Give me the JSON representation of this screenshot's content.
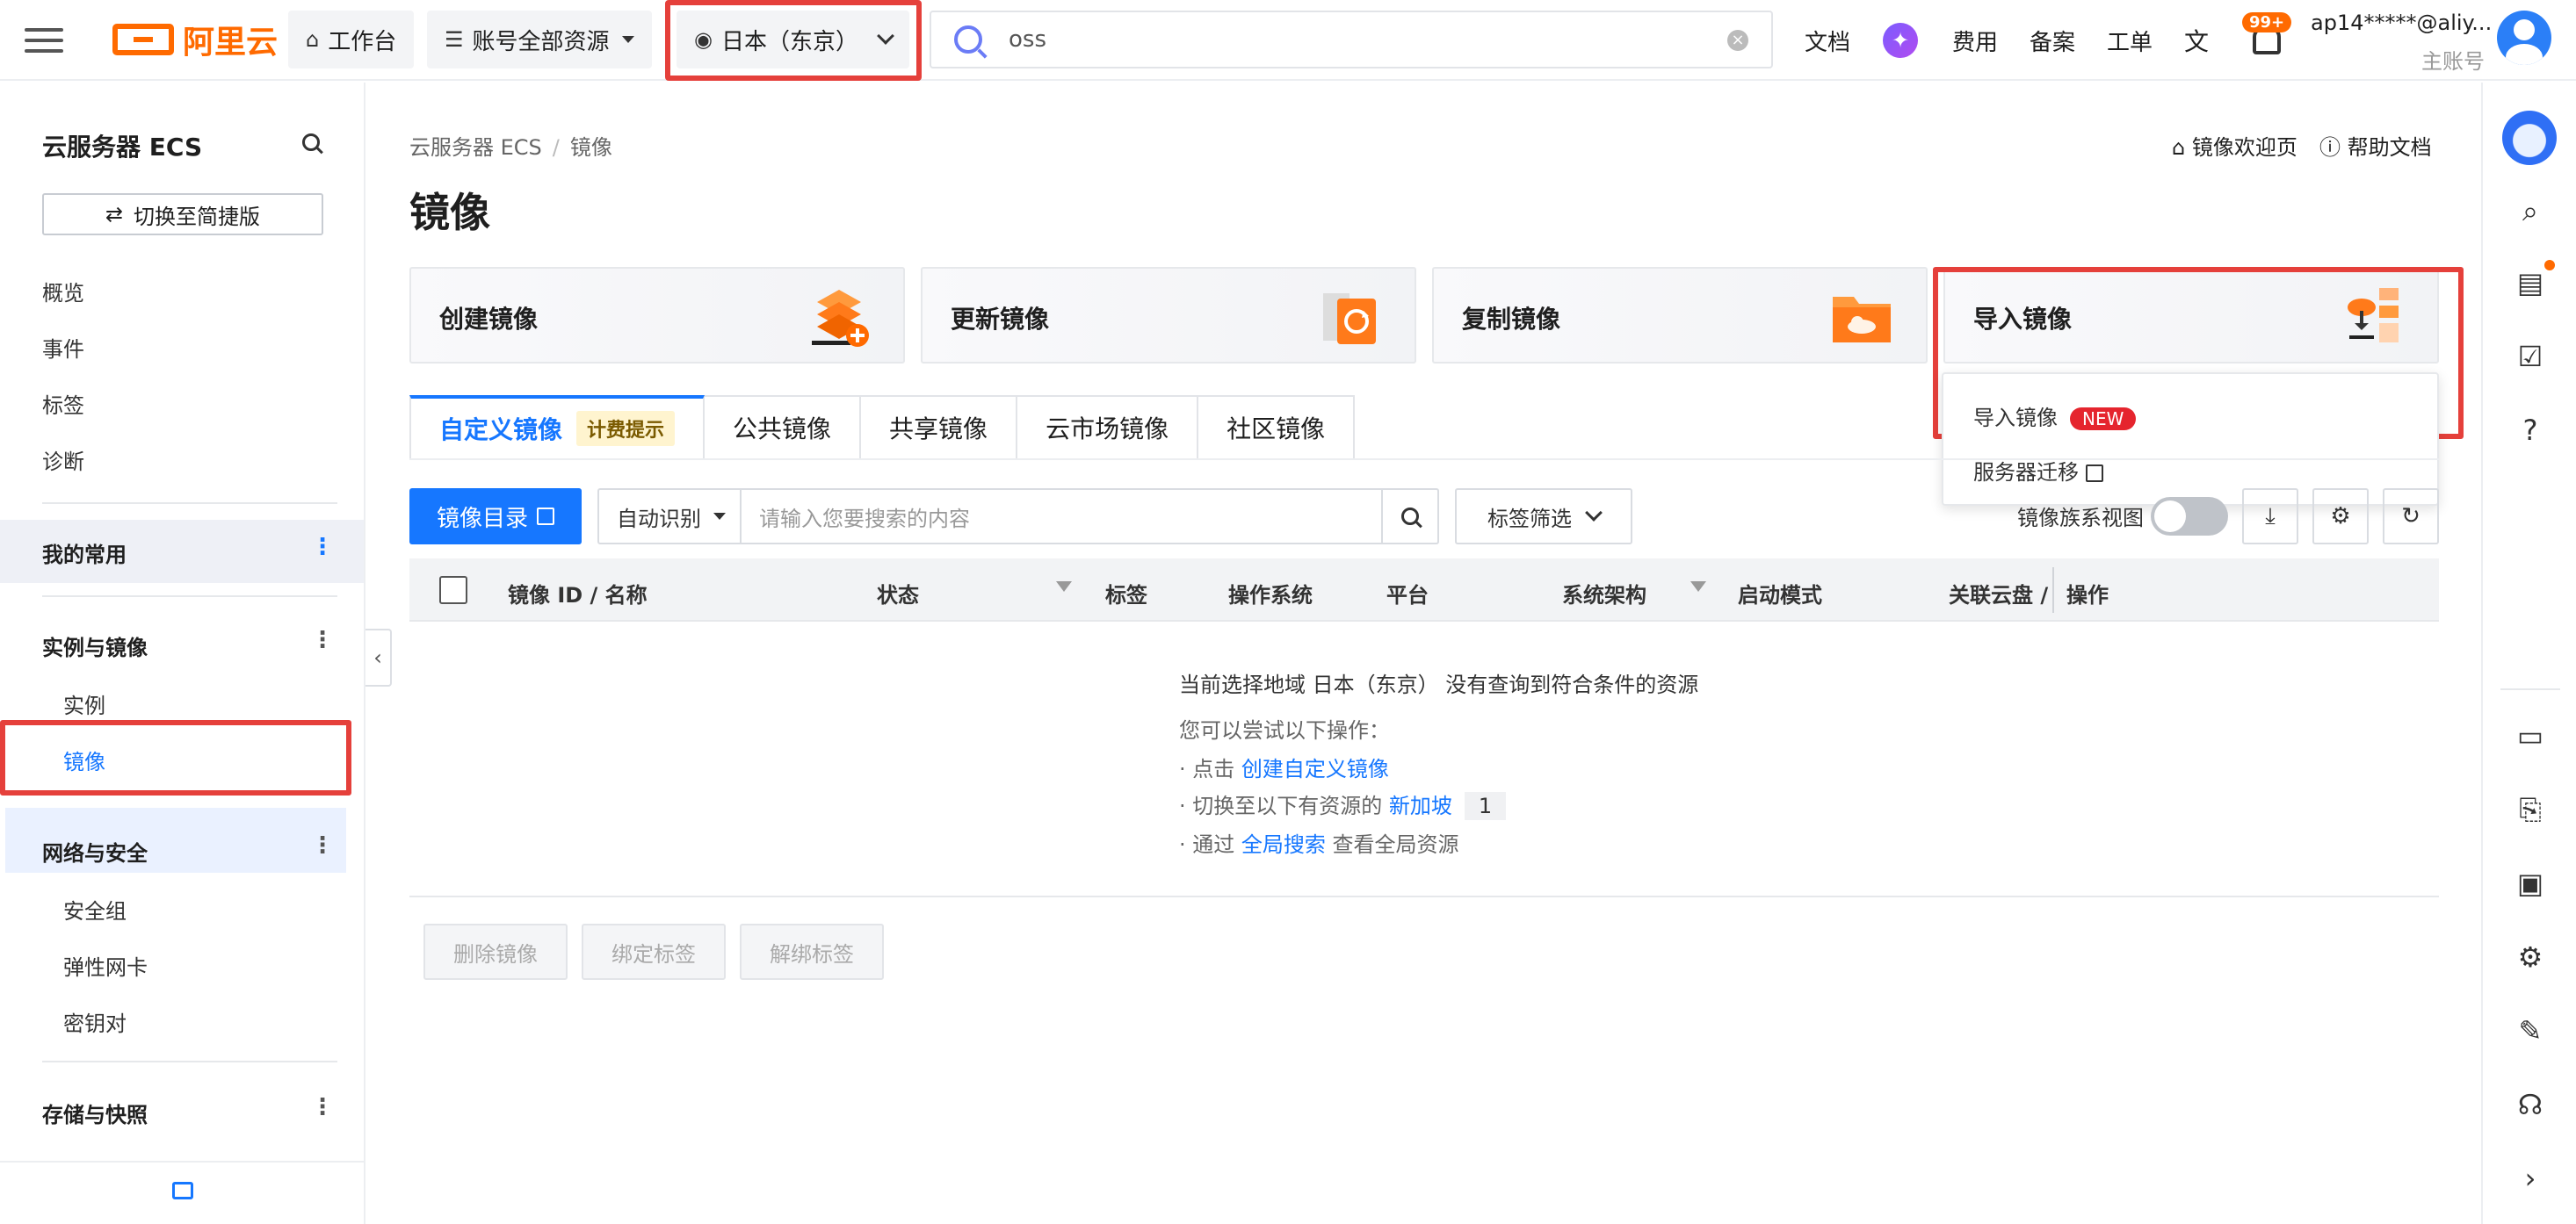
{
  "topbar": {
    "logo_text": "阿里云",
    "workbench": "工作台",
    "resources": "账号全部资源",
    "region": "日本（东京）",
    "search_value": "oss",
    "links": [
      "文档",
      "费用",
      "备案",
      "工单"
    ],
    "notif_count": "99+",
    "account": "ap14*****@aliy...",
    "account_sub": "主账号"
  },
  "sidebar": {
    "title": "云服务器 ECS",
    "switch_label": "切换至简捷版",
    "top_items": [
      "概览",
      "事件",
      "标签",
      "诊断"
    ],
    "favorites": "我的常用",
    "section_instances": "实例与镜像",
    "instances_items": [
      "实例",
      "镜像"
    ],
    "section_network": "网络与安全",
    "network_items": [
      "安全组",
      "弹性网卡",
      "密钥对"
    ],
    "section_storage": "存储与快照"
  },
  "main": {
    "breadcrumb": [
      "云服务器 ECS",
      "镜像"
    ],
    "title": "镜像",
    "welcome_link": "镜像欢迎页",
    "help_link": "帮助文档",
    "cards": [
      "创建镜像",
      "更新镜像",
      "复制镜像",
      "导入镜像"
    ],
    "import_menu": {
      "item1": "导入镜像",
      "new_badge": "NEW",
      "item2": "服务器迁移"
    },
    "tabs": [
      "自定义镜像",
      "公共镜像",
      "共享镜像",
      "云市场镜像",
      "社区镜像"
    ],
    "fee_tip": "计费提示",
    "catalog_button": "镜像目录",
    "filter_select": "自动识别",
    "filter_placeholder": "请输入您要搜索的内容",
    "tag_filter": "标签筛选",
    "family_view": "镜像族系视图",
    "columns": [
      "镜像 ID / 名称",
      "状态",
      "标签",
      "操作系统",
      "平台",
      "系统架构",
      "启动模式",
      "关联云盘 /",
      "操作"
    ],
    "empty": {
      "line1": "当前选择地域 日本（东京） 没有查询到符合条件的资源",
      "line2": "您可以尝试以下操作：",
      "tip1_prefix": "点击",
      "tip1_link": "创建自定义镜像",
      "tip2_prefix": "切换至以下有资源的",
      "tip2_link": "新加坡",
      "tip2_count": "1",
      "tip3_prefix": "通过",
      "tip3_link": "全局搜索",
      "tip3_suffix": "查看全局资源"
    },
    "bulk_buttons": [
      "删除镜像",
      "绑定标签",
      "解绑标签"
    ]
  }
}
